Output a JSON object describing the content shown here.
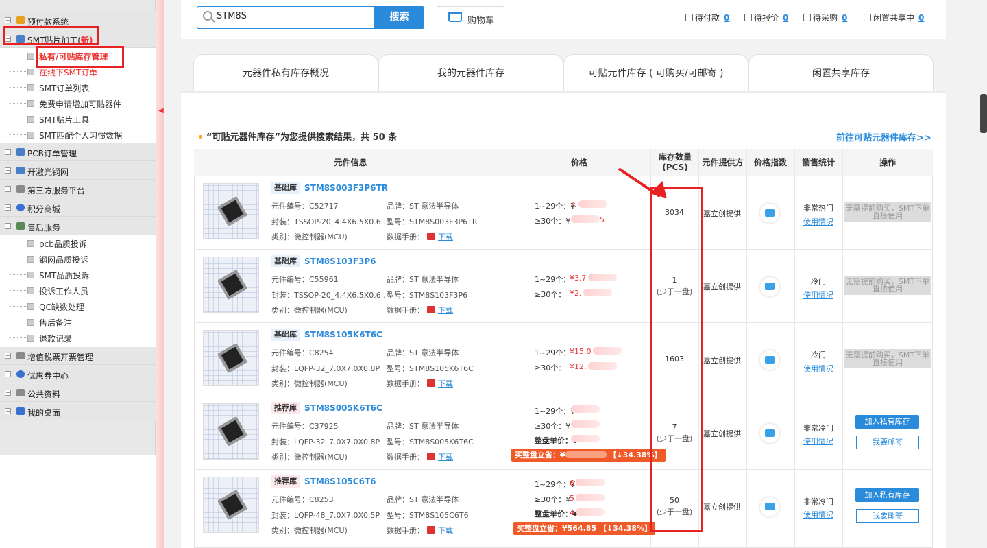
{
  "sidebar": {
    "items": [
      {
        "label": "预付款系统"
      },
      {
        "label": "SMT贴片加工(",
        "new": "新)"
      },
      {
        "label": "PCB订单管理"
      },
      {
        "label": "开激光钢网"
      },
      {
        "label": "第三方服务平台"
      },
      {
        "label": "积分商城"
      },
      {
        "label": "售后服务"
      },
      {
        "label": "增值税票开票管理"
      },
      {
        "label": "优惠券中心"
      },
      {
        "label": "公共资料"
      },
      {
        "label": "我的桌面"
      }
    ],
    "smt_sub": [
      {
        "label": "私有/可贴库存管理"
      },
      {
        "label": "在线下SMT订单"
      },
      {
        "label": "SMT订单列表"
      },
      {
        "label": "免费申请增加可贴器件"
      },
      {
        "label": "SMT贴片工具"
      },
      {
        "label": "SMT匹配个人习惯数据"
      }
    ],
    "after_sales_sub": [
      {
        "label": "pcb品质投诉"
      },
      {
        "label": "钢网品质投诉"
      },
      {
        "label": "SMT品质投诉"
      },
      {
        "label": "投诉工作人员"
      },
      {
        "label": "QC缺数处理"
      },
      {
        "label": "售后备注"
      },
      {
        "label": "退款记录"
      }
    ]
  },
  "search": {
    "value": "STM8S",
    "button": "搜索"
  },
  "cart": {
    "label": "购物车"
  },
  "stats": [
    {
      "label": "待付款",
      "value": "0"
    },
    {
      "label": "待报价",
      "value": "0"
    },
    {
      "label": "待采购",
      "value": "0"
    },
    {
      "label": "闲置共享中",
      "value": "0"
    }
  ],
  "tabs": [
    {
      "label": "元器件私有库存概况"
    },
    {
      "label": "我的元器件库存"
    },
    {
      "label": "可贴元件库存 ( 可购买/可邮寄 )"
    },
    {
      "label": "闲置共享库存"
    }
  ],
  "results": {
    "title": "“可贴元器件库存”为您提供搜索结果，共 50 条",
    "goto": "前往可贴元器件库存>>"
  },
  "table": {
    "headers": [
      "元件信息",
      "价格",
      "库存数量(PCS)",
      "元件提供方",
      "价格指数",
      "销售统计",
      "操作"
    ],
    "rows": [
      {
        "badge": "基础库",
        "badge_type": "basic",
        "name": "STM8S003F3P6TR",
        "code": "元件编号：C52717",
        "brand": "品牌：ST 意法半导体",
        "package": "封装：TSSOP-20_4.4X6.5X0.6...",
        "model": "型号：STM8S003F3P6TR",
        "category": "类别：微控制器(MCU)",
        "datasheet": "数据手册：",
        "download": "下载",
        "price_tiers": [
          "1~29个：¥",
          "≥30个：¥"
        ],
        "price_values": [
          "7.",
          "5"
        ],
        "qty": "3034",
        "qty_note": "",
        "supplier": "嘉立创提供",
        "sales": "非常热门",
        "usage": "使用情况",
        "op_disabled": "无需提前购买，SMT下单直接使用"
      },
      {
        "badge": "基础库",
        "badge_type": "basic",
        "name": "STM8S103F3P6",
        "code": "元件编号：C55961",
        "brand": "品牌：ST 意法半导体",
        "package": "封装：TSSOP-20_4.4X6.5X0.6...",
        "model": "型号：STM8S103F3P6",
        "category": "类别：微控制器(MCU)",
        "datasheet": "数据手册：",
        "download": "下载",
        "price_tiers": [
          "1~29个：",
          "≥30个："
        ],
        "price_values": [
          "¥3.7",
          "¥2."
        ],
        "qty": "1",
        "qty_note": "(少于一盘)",
        "supplier": "嘉立创提供",
        "sales": "冷门",
        "usage": "使用情况",
        "op_disabled": "无需提前购买，SMT下单直接使用"
      },
      {
        "badge": "基础库",
        "badge_type": "basic",
        "name": "STM8S105K6T6C",
        "code": "元件编号：C8254",
        "brand": "品牌：ST 意法半导体",
        "package": "封装：LQFP-32_7.0X7.0X0.8P",
        "model": "型号：STM8S105K6T6C",
        "category": "类别：微控制器(MCU)",
        "datasheet": "数据手册：",
        "download": "下载",
        "price_tiers": [
          "1~29个：",
          "≥30个："
        ],
        "price_values": [
          "¥15.0",
          "¥12."
        ],
        "qty": "1603",
        "qty_note": "",
        "supplier": "嘉立创提供",
        "sales": "冷门",
        "usage": "使用情况",
        "op_disabled": "无需提前购买，SMT下单直接使用"
      },
      {
        "badge": "推荐库",
        "badge_type": "rec",
        "name": "STM8S005K6T6C",
        "code": "元件编号：C37925",
        "brand": "品牌：ST 意法半导体",
        "package": "封装：LQFP-32_7.0X7.0X0.8P",
        "model": "型号：STM8S005K6T6C",
        "category": "类别：微控制器(MCU)",
        "datasheet": "数据手册：",
        "download": "下载",
        "price_tiers": [
          "1~29个：¥",
          "≥30个：¥",
          "整盘单价：¥"
        ],
        "price_values": [
          "",
          "",
          ""
        ],
        "deal": "买整盘立省：¥",
        "deal_pct": "↓34.38%】",
        "qty": "7",
        "qty_note": "(少于一盘)",
        "supplier": "嘉立创提供",
        "sales": "非常冷门",
        "usage": "使用情况",
        "op_primary": "加入私有库存",
        "op_secondary": "我要邮寄"
      },
      {
        "badge": "推荐库",
        "badge_type": "rec",
        "name": "STM8S105C6T6",
        "code": "元件编号：C8253",
        "brand": "品牌：ST 意法半导体",
        "package": "封装：LQFP-48_7.0X7.0X0.5P",
        "model": "型号：STM8S105C6T6",
        "category": "类别：微控制器(MCU)",
        "datasheet": "数据手册：",
        "download": "下载",
        "price_tiers": [
          "1~29个：¥",
          "≥30个：¥",
          "整盘单价：¥"
        ],
        "price_values": [
          "6",
          "5",
          "4"
        ],
        "deal": "买整盘立省：¥564.85",
        "deal_pct": "↓34.38%】",
        "qty": "50",
        "qty_note": "(少于一盘)",
        "supplier": "嘉立创提供",
        "sales": "非常冷门",
        "usage": "使用情况",
        "op_primary": "加入私有库存",
        "op_secondary": "我要邮寄"
      }
    ]
  },
  "colors": {
    "accent": "#2b8bdb",
    "highlight": "#e62222",
    "price": "#e33333",
    "deal": "#f05a28"
  }
}
